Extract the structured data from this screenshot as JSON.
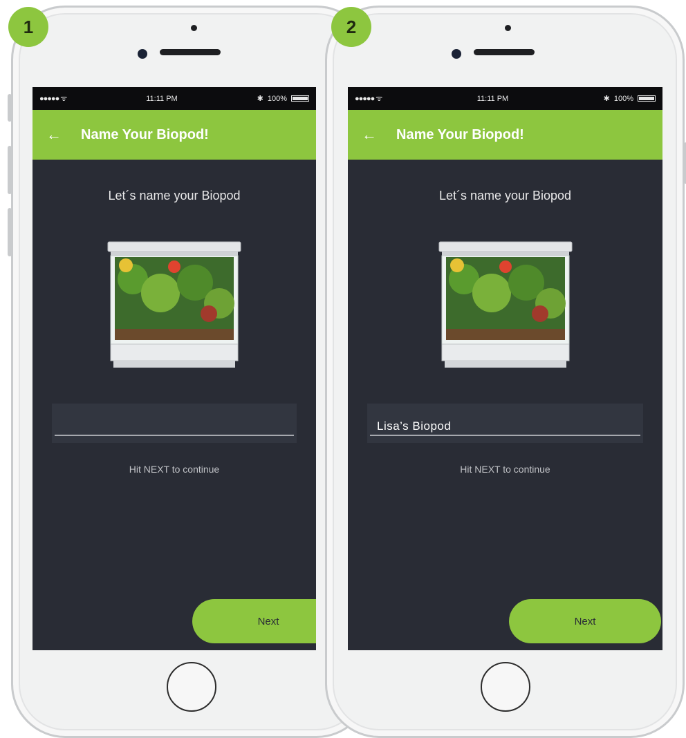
{
  "colors": {
    "accent": "#8dc63f",
    "screen_bg": "#292c35",
    "field_bg": "#323640"
  },
  "phones": [
    {
      "step": "1",
      "status": {
        "time": "11:11 PM",
        "battery": "100%"
      },
      "appbar": {
        "back_icon": "arrow-left-icon",
        "title": "Name Your Biopod!"
      },
      "heading": "Let´s name your Biopod",
      "name_field": {
        "value": ""
      },
      "hint": "Hit NEXT to continue",
      "next_label": "Next"
    },
    {
      "step": "2",
      "status": {
        "time": "11:11 PM",
        "battery": "100%"
      },
      "appbar": {
        "back_icon": "arrow-left-icon",
        "title": "Name Your Biopod!"
      },
      "heading": "Let´s name your Biopod",
      "name_field": {
        "value": "Lisa’s Biopod"
      },
      "hint": "Hit NEXT to continue",
      "next_label": "Next"
    }
  ]
}
